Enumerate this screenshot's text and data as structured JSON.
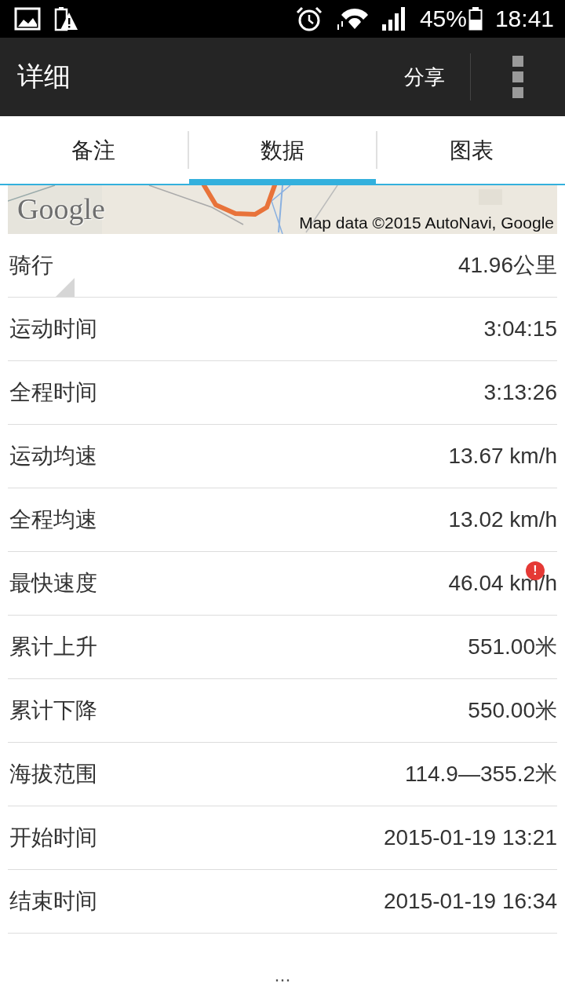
{
  "status_bar": {
    "battery_percent": "45%",
    "time": "18:41"
  },
  "app_bar": {
    "title": "详细",
    "action": "分享"
  },
  "tabs": [
    {
      "label": "备注",
      "selected": false
    },
    {
      "label": "数据",
      "selected": true
    },
    {
      "label": "图表",
      "selected": false
    }
  ],
  "map": {
    "logo": "Google",
    "attribution": "Map data ©2015 AutoNavi, Google"
  },
  "stats": [
    {
      "label": "骑行",
      "value": "41.96公里",
      "dropdown": true
    },
    {
      "label": "运动时间",
      "value": "3:04:15"
    },
    {
      "label": "全程时间",
      "value": "3:13:26"
    },
    {
      "label": "运动均速",
      "value": "13.67 km/h"
    },
    {
      "label": "全程均速",
      "value": "13.02 km/h"
    },
    {
      "label": "最快速度",
      "value": "46.04 km/h",
      "badge": "!"
    },
    {
      "label": "累计上升",
      "value": "551.00米"
    },
    {
      "label": "累计下降",
      "value": "550.00米"
    },
    {
      "label": "海拔范围",
      "value": "114.9—355.2米"
    },
    {
      "label": "开始时间",
      "value": "2015-01-19 13:21"
    },
    {
      "label": "结束时间",
      "value": "2015-01-19 16:34"
    }
  ],
  "more": "..."
}
